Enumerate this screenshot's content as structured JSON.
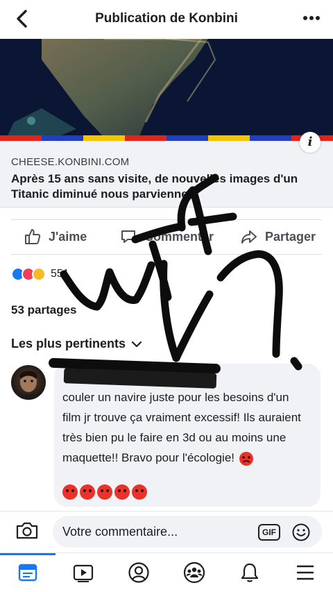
{
  "header": {
    "title": "Publication de Konbini",
    "back_icon": "chevron-left-icon",
    "more_icon": "ellipsis-icon"
  },
  "link_preview": {
    "domain": "CHEESE.KONBINI.COM",
    "headline": "Après 15 ans sans visite, de nouvelles images d'un Titanic diminué nous parviennent",
    "info_icon": "info-icon",
    "stripe_colors": [
      "#e2231a",
      "#1f3fbf",
      "#f5c400",
      "#e2231a",
      "#1f3fbf",
      "#f5c400",
      "#1f3fbf",
      "#e2231a"
    ]
  },
  "actions": {
    "like": "J'aime",
    "comment": "Commenter",
    "share": "Partager"
  },
  "stats": {
    "reactions_count": "551",
    "shares": "53 partages",
    "sort_label": "Les plus pertinents"
  },
  "comment": {
    "text": "couler un navire juste pour les besoins d'un film jr trouve ça vraiment excessif! Ils auraient très bien pu le faire en 3d ou au moins une maquette!! Bravo pour l'écologie!",
    "emoji_name": "angry-face-icon"
  },
  "composer": {
    "placeholder": "Votre commentaire...",
    "gif_label": "GIF"
  },
  "colors": {
    "accent": "#1877f2",
    "bubble": "#f0f2f5",
    "text": "#1c1e21"
  },
  "annotation": {
    "scribble_text": "WTF"
  }
}
